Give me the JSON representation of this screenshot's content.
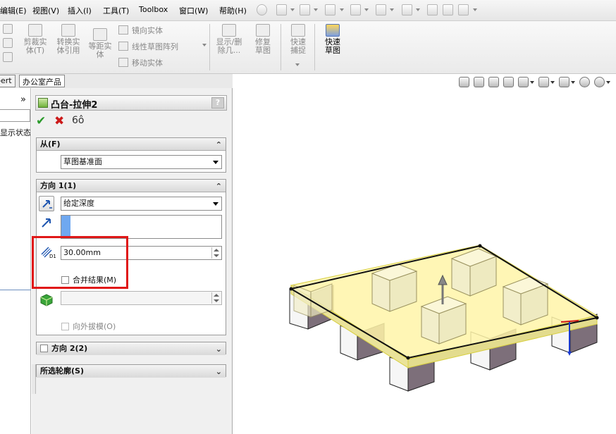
{
  "menu": {
    "items": [
      "编辑(E)",
      "视图(V)",
      "插入(I)",
      "工具(T)",
      "Toolbox",
      "窗口(W)",
      "帮助(H)"
    ]
  },
  "toolbar": {
    "trim_entities": "剪裁实体(T)",
    "convert_entities": "转换实体引用",
    "offset_entities": "等距实体",
    "mirror_entities": "镜向实体",
    "linear_pattern": "线性草图阵列",
    "move_entities": "移动实体",
    "show_hide_relations": "显示/删除几...",
    "repair_sketch": "修复草图",
    "quick_snaps": "快速捕捉",
    "rapid_sketch": "快速草图"
  },
  "tabs": [
    "pert",
    "办公室产品"
  ],
  "tree": {
    "chevron": "»",
    "display_state": "显示状态"
  },
  "property_manager": {
    "title": "凸台-拉伸2",
    "help": "?",
    "from_section": {
      "header": "从(F)",
      "value": "草图基准面"
    },
    "direction1": {
      "header": "方向 1(1)",
      "end_condition": "给定深度",
      "depth_value": "30.00mm",
      "merge_result": "合并结果(M)",
      "draft_outward": "向外拔模(O)"
    },
    "direction2": {
      "header": "方向 2(2)"
    },
    "selected_contours": {
      "header": "所选轮廓(S)"
    }
  },
  "colors": {
    "highlight_rect": "#e01818",
    "preview_fill": "#f5f09a",
    "block_face_light": "#f2eed0",
    "block_face_dark": "#7a6d78",
    "accent_green": "#2a9a2a",
    "accent_red": "#cc1a1a"
  },
  "icons": [
    "ok-check-icon",
    "cancel-x-icon",
    "detailed-preview-icon",
    "reverse-direction-icon",
    "direction-arrow-icon",
    "depth-icon",
    "feature-scope-icon",
    "zoom-to-fit-icon",
    "zoom-area-icon",
    "previous-view-icon",
    "section-view-icon",
    "view-orientation-icon",
    "display-style-icon",
    "hide-show-icon",
    "appearance-icon",
    "scene-icon"
  ]
}
